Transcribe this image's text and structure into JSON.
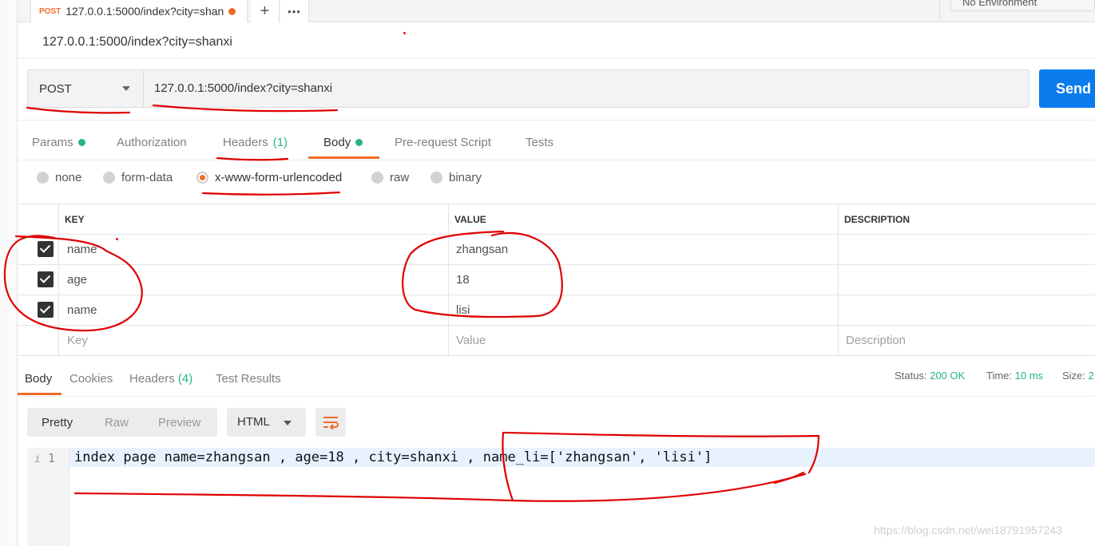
{
  "tab": {
    "method": "POST",
    "title": "127.0.0.1:5000/index?city=shan",
    "new_tab_glyph": "+",
    "more_glyph": "•••"
  },
  "environment": {
    "label": "No Environment"
  },
  "request": {
    "name": "127.0.0.1:5000/index?city=shanxi",
    "method": "POST",
    "url": "127.0.0.1:5000/index?city=shanxi",
    "send_label": "Send"
  },
  "request_tabs": {
    "params": "Params",
    "authorization": "Authorization",
    "headers": "Headers",
    "headers_count": "(1)",
    "body": "Body",
    "prerequest": "Pre-request Script",
    "tests": "Tests"
  },
  "body_types": {
    "none": "none",
    "form_data": "form-data",
    "urlencoded": "x-www-form-urlencoded",
    "raw": "raw",
    "binary": "binary",
    "selected": "x-www-form-urlencoded"
  },
  "params_table": {
    "headers": {
      "key": "KEY",
      "value": "VALUE",
      "description": "DESCRIPTION"
    },
    "rows": [
      {
        "checked": true,
        "key": "name",
        "value": "zhangsan",
        "description": ""
      },
      {
        "checked": true,
        "key": "age",
        "value": "18",
        "description": ""
      },
      {
        "checked": true,
        "key": "name",
        "value": "lisi",
        "description": ""
      }
    ],
    "placeholders": {
      "key": "Key",
      "value": "Value",
      "description": "Description"
    }
  },
  "response": {
    "tabs": {
      "body": "Body",
      "cookies": "Cookies",
      "headers": "Headers",
      "headers_count": "(4)",
      "test_results": "Test Results"
    },
    "status_label": "Status:",
    "status_value": "200 OK",
    "time_label": "Time:",
    "time_value": "10 ms",
    "size_label": "Size:",
    "size_value": "2",
    "view_modes": {
      "pretty": "Pretty",
      "raw": "Raw",
      "preview": "Preview"
    },
    "format": "HTML",
    "line_number": "1",
    "line_marker": "i",
    "code": "index page name=zhangsan , age=18 , city=shanxi , name_li=['zhangsan', 'lisi']"
  },
  "watermark": "https://blog.csdn.net/wei18791957243",
  "colors": {
    "accent_orange": "#f06c2b",
    "send_blue": "#097bed",
    "ok_green": "#26b47f",
    "annotation_red": "#e00000"
  }
}
